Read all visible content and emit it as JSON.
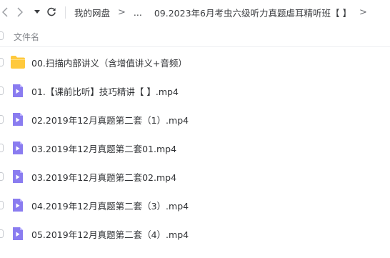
{
  "toolbar": {
    "breadcrumb": [
      "我的网盘",
      "...",
      "09.2023年6月考虫六级听力真题虐耳精听班【 】"
    ]
  },
  "header": {
    "name_col": "文件名"
  },
  "files": [
    {
      "name": "00.扫描内部讲义（含增值讲义+音频）",
      "type": "folder"
    },
    {
      "name": "01.【课前比听】技巧精讲【 】.mp4",
      "type": "video"
    },
    {
      "name": "02.2019年12月真题第二套（1）.mp4",
      "type": "video"
    },
    {
      "name": "03.2019年12月真题第二套01.mp4",
      "type": "video"
    },
    {
      "name": "03.2019年12月真题第二套02.mp4",
      "type": "video"
    },
    {
      "name": "04.2019年12月真题第二套（3）.mp4",
      "type": "video"
    },
    {
      "name": "05.2019年12月真题第二套（4）.mp4",
      "type": "video"
    }
  ],
  "colors": {
    "folder": "#ffc93c",
    "video": "#8a7cf0"
  }
}
